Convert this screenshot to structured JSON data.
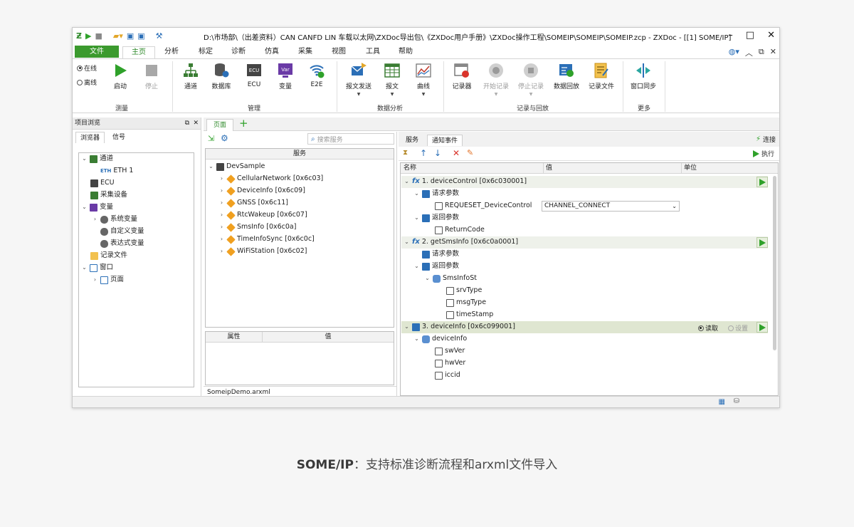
{
  "window": {
    "title": "D:\\市场部\\（出差资料）CAN CANFD LIN 车载以太网\\ZXDoc导出包\\《ZXDoc用户手册》\\ZXDoc操作工程\\SOMEIP\\SOMEIP\\SOMEIP.zcp - ZXDoc - [[1] SOME/IP]"
  },
  "menu": {
    "file": "文件",
    "tabs": [
      "主页",
      "分析",
      "标定",
      "诊断",
      "仿真",
      "采集",
      "视图",
      "工具",
      "帮助"
    ]
  },
  "ribbon": {
    "online": "在线",
    "offline": "离线",
    "start": "启动",
    "stop": "停止",
    "group_measure": "测量",
    "channel": "通道",
    "database": "数据库",
    "ecu": "ECU",
    "variable": "变量",
    "e2e": "E2E",
    "group_manage": "管理",
    "msg_send": "报文发送",
    "message": "报文",
    "curve": "曲线",
    "group_analysis": "数据分析",
    "recorder": "记录器",
    "start_record": "开始记录",
    "stop_record": "停止记录",
    "data_replay": "数据回放",
    "record_file": "记录文件",
    "group_record": "记录与回放",
    "window_sync": "窗口同步",
    "group_more": "更多",
    "icon_text_ecu": "ECU",
    "icon_text_var": "Var"
  },
  "project": {
    "header": "项目浏览",
    "tabs": [
      "浏览器",
      "信号"
    ],
    "tree": {
      "channel": "通道",
      "eth": "ETH 1",
      "eth_tag": "ETH",
      "ecu": "ECU",
      "acq": "采集设备",
      "variable": "变量",
      "sysvar": "系统变量",
      "customvar": "自定义变量",
      "exprvar": "表达式变量",
      "recfile": "记录文件",
      "window": "窗口",
      "page": "页面"
    }
  },
  "page_tab": "页面",
  "services_panel": {
    "search_placeholder": "搜索服务",
    "header": "服务",
    "root": "DevSample",
    "items": [
      "CellularNetwork [0x6c03]",
      "DeviceInfo [0x6c09]",
      "GNSS [0x6c11]",
      "RtcWakeup [0x6c07]",
      "SmsInfo [0x6c0a]",
      "TimeInfoSync [0x6c0c]",
      "WiFiStation [0x6c02]"
    ],
    "prop_col": "属性",
    "value_col": "值",
    "status_file": "SomeipDemo.arxml"
  },
  "detail": {
    "tabs": [
      "服务",
      "通知事件"
    ],
    "connect": "连接",
    "execute": "执行",
    "col_name": "名称",
    "col_value": "值",
    "col_unit": "单位",
    "fx_label": "fx",
    "rows": {
      "m1": "1. deviceControl [0x6c030001]",
      "req": "请求参数",
      "p1": "REQUESET_DeviceControl",
      "p1_value": "CHANNEL_CONNECT",
      "ret": "返回参数",
      "rc": "ReturnCode",
      "m2": "2. getSmsInfo [0x6c0a0001]",
      "req2": "请求参数",
      "ret2": "返回参数",
      "smsst": "SmsInfoSt",
      "srv": "srvType",
      "msgt": "msgType",
      "ts": "timeStamp",
      "m3": "3. deviceInfo [0x6c099001]",
      "read": "读取",
      "set": "设置",
      "devinfo": "deviceInfo",
      "sw": "swVer",
      "hw": "hwVer",
      "iccid": "iccid"
    }
  },
  "caption": {
    "bold": "SOME/IP",
    "rest": "：支持标准诊断流程和arxml文件导入"
  }
}
